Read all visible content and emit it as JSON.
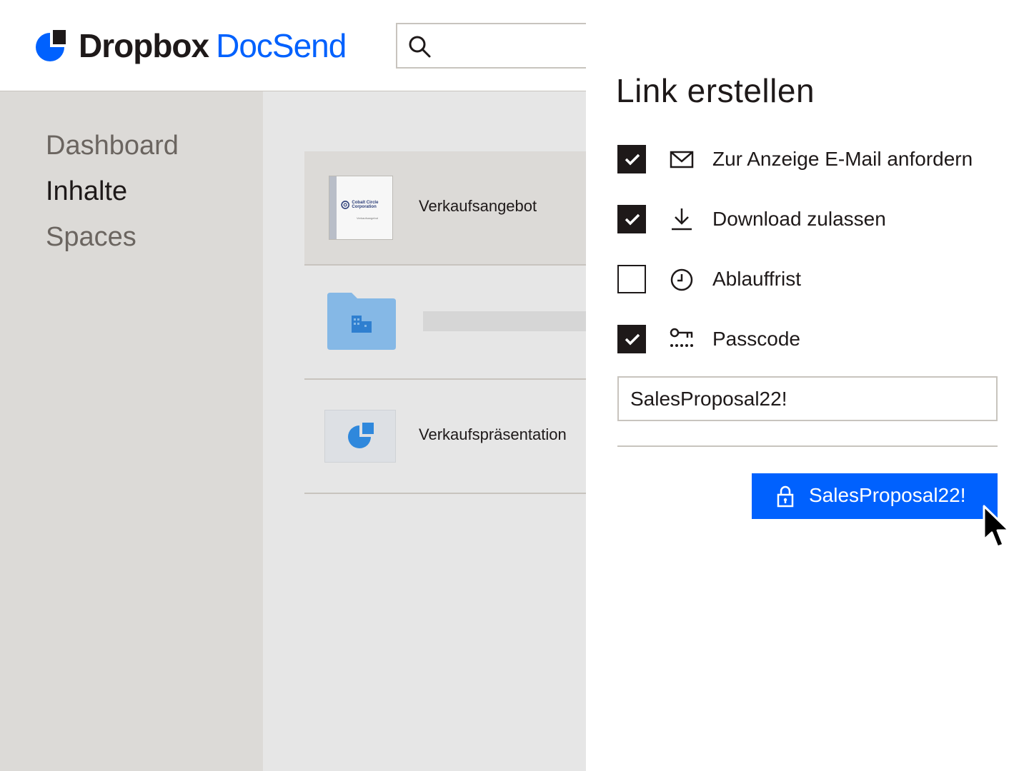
{
  "header": {
    "brand_primary": "Dropbox",
    "brand_secondary": "DocSend",
    "search_placeholder": ""
  },
  "sidebar": {
    "items": [
      {
        "label": "Dashboard",
        "active": false
      },
      {
        "label": "Inhalte",
        "active": true
      },
      {
        "label": "Spaces",
        "active": false
      }
    ]
  },
  "content": {
    "rows": [
      {
        "type": "document",
        "title": "Verkaufsangebot",
        "thumb_company": "Cobalt Circle Corporation",
        "thumb_subtitle": "Verkaufsangebot"
      },
      {
        "type": "folder",
        "title": ""
      },
      {
        "type": "presentation",
        "title": "Verkaufspräsentation"
      }
    ]
  },
  "panel": {
    "title": "Link erstellen",
    "options": [
      {
        "label": "Zur Anzeige E-Mail anfordern",
        "checked": true,
        "icon": "mail-icon"
      },
      {
        "label": "Download zulassen",
        "checked": true,
        "icon": "download-icon"
      },
      {
        "label": "Ablauffrist",
        "checked": false,
        "icon": "clock-icon"
      },
      {
        "label": "Passcode",
        "checked": true,
        "icon": "key-icon"
      }
    ],
    "passcode_value": "SalesProposal22!",
    "button_label": "SalesProposal22!"
  },
  "colors": {
    "accent": "#0061fe",
    "text": "#1e1919",
    "muted_text": "#6b6560",
    "sidebar_bg": "#dcdad7",
    "content_bg": "#e6e6e6",
    "border": "#c8c4be"
  }
}
